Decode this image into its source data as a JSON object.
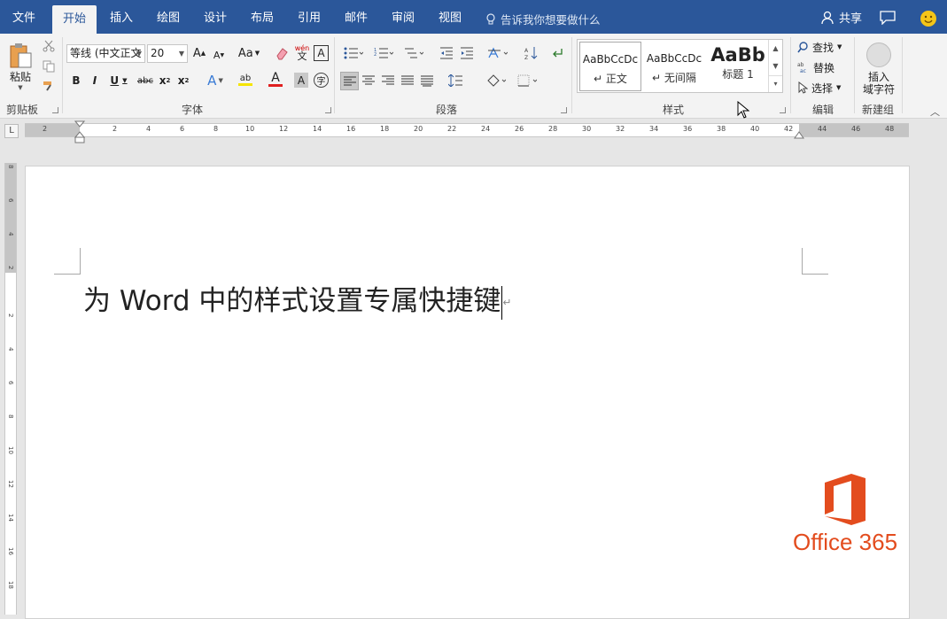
{
  "tabs": [
    "文件",
    "开始",
    "插入",
    "绘图",
    "设计",
    "布局",
    "引用",
    "邮件",
    "审阅",
    "视图"
  ],
  "active_tab": "开始",
  "tell_me": "告诉我你想要做什么",
  "share_label": "共享",
  "clipboard": {
    "paste": "粘贴",
    "group": "剪贴板"
  },
  "font": {
    "name": "等线 (中文正文",
    "size": "20",
    "group": "字体",
    "change_case": "Aa",
    "phonetic": "wén"
  },
  "paragraph": {
    "group": "段落"
  },
  "styles": {
    "group": "样式",
    "items": [
      {
        "preview": "AaBbCcDc",
        "name": "正文"
      },
      {
        "preview": "AaBbCcDc",
        "name": "无间隔"
      },
      {
        "preview": "AaBb",
        "name": "标题 1"
      }
    ]
  },
  "editing": {
    "find": "查找",
    "replace": "替换",
    "select": "选择",
    "group": "编辑"
  },
  "new_group": {
    "insert_field_line1": "插入",
    "insert_field_line2": "域字符",
    "group": "新建组"
  },
  "ruler": {
    "corner": "L",
    "h_numbers": [
      "2",
      "2",
      "4",
      "6",
      "8",
      "10",
      "12",
      "14",
      "16",
      "18",
      "20",
      "22",
      "24",
      "26",
      "28",
      "30",
      "32",
      "34",
      "36",
      "38",
      "40",
      "42",
      "44",
      "46",
      "48"
    ],
    "v_numbers": [
      "8",
      "6",
      "4",
      "2",
      "2",
      "4",
      "6",
      "8",
      "10",
      "12",
      "14",
      "16",
      "18"
    ]
  },
  "document": {
    "text": "为 Word 中的样式设置专属快捷键",
    "para_mark": "↵"
  },
  "logo": {
    "text": "Office 365",
    "color": "#e34c1e"
  },
  "colors": {
    "title_bar": "#2b579a",
    "ribbon": "#f3f3f3",
    "font_color_underline": "#e02020",
    "highlight_underline": "#f5e500"
  }
}
